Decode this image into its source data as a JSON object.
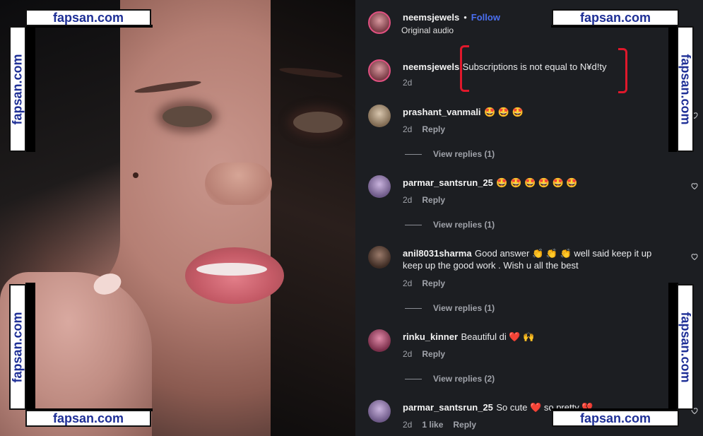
{
  "watermark": {
    "text": "fapsan.com"
  },
  "post": {
    "username": "neemsjewels",
    "separator": "•",
    "follow_label": "Follow",
    "audio_label": "Original audio"
  },
  "comments": [
    {
      "username": "neemsjewels",
      "text": "Subscriptions is not equal to N¥d!ty",
      "age": "2d",
      "reply": "",
      "likes": "",
      "view_replies": ""
    },
    {
      "username": "prashant_vanmali",
      "text": "🤩 🤩 🤩",
      "age": "2d",
      "reply": "Reply",
      "likes": "",
      "view_replies": "View replies (1)"
    },
    {
      "username": "parmar_santsrun_25",
      "text": "🤩 🤩 🤩 🤩 🤩 🤩",
      "age": "2d",
      "reply": "Reply",
      "likes": "",
      "view_replies": "View replies (1)"
    },
    {
      "username": "anil8031sharma",
      "text": "Good answer 👏 👏 👏 well said keep it up",
      "text2": "keep up the good work . Wish u all the best",
      "age": "2d",
      "reply": "Reply",
      "likes": "",
      "view_replies": "View replies (1)"
    },
    {
      "username": "rinku_kinner",
      "text": "Beautiful di ❤️ 🙌",
      "age": "2d",
      "reply": "Reply",
      "likes": "",
      "view_replies": "View replies (2)"
    },
    {
      "username": "parmar_santsrun_25",
      "text": "So cute ❤️ so pretty 💔",
      "age": "2d",
      "reply": "Reply",
      "likes": "1 like",
      "view_replies": ""
    }
  ],
  "icons": {
    "heart": "heart-icon",
    "avatar": "avatar"
  },
  "colors": {
    "panel_bg": "#1c1e22",
    "follow": "#4a6ff1",
    "watermark": "#1e2f96",
    "annotation": "#e0182b"
  }
}
